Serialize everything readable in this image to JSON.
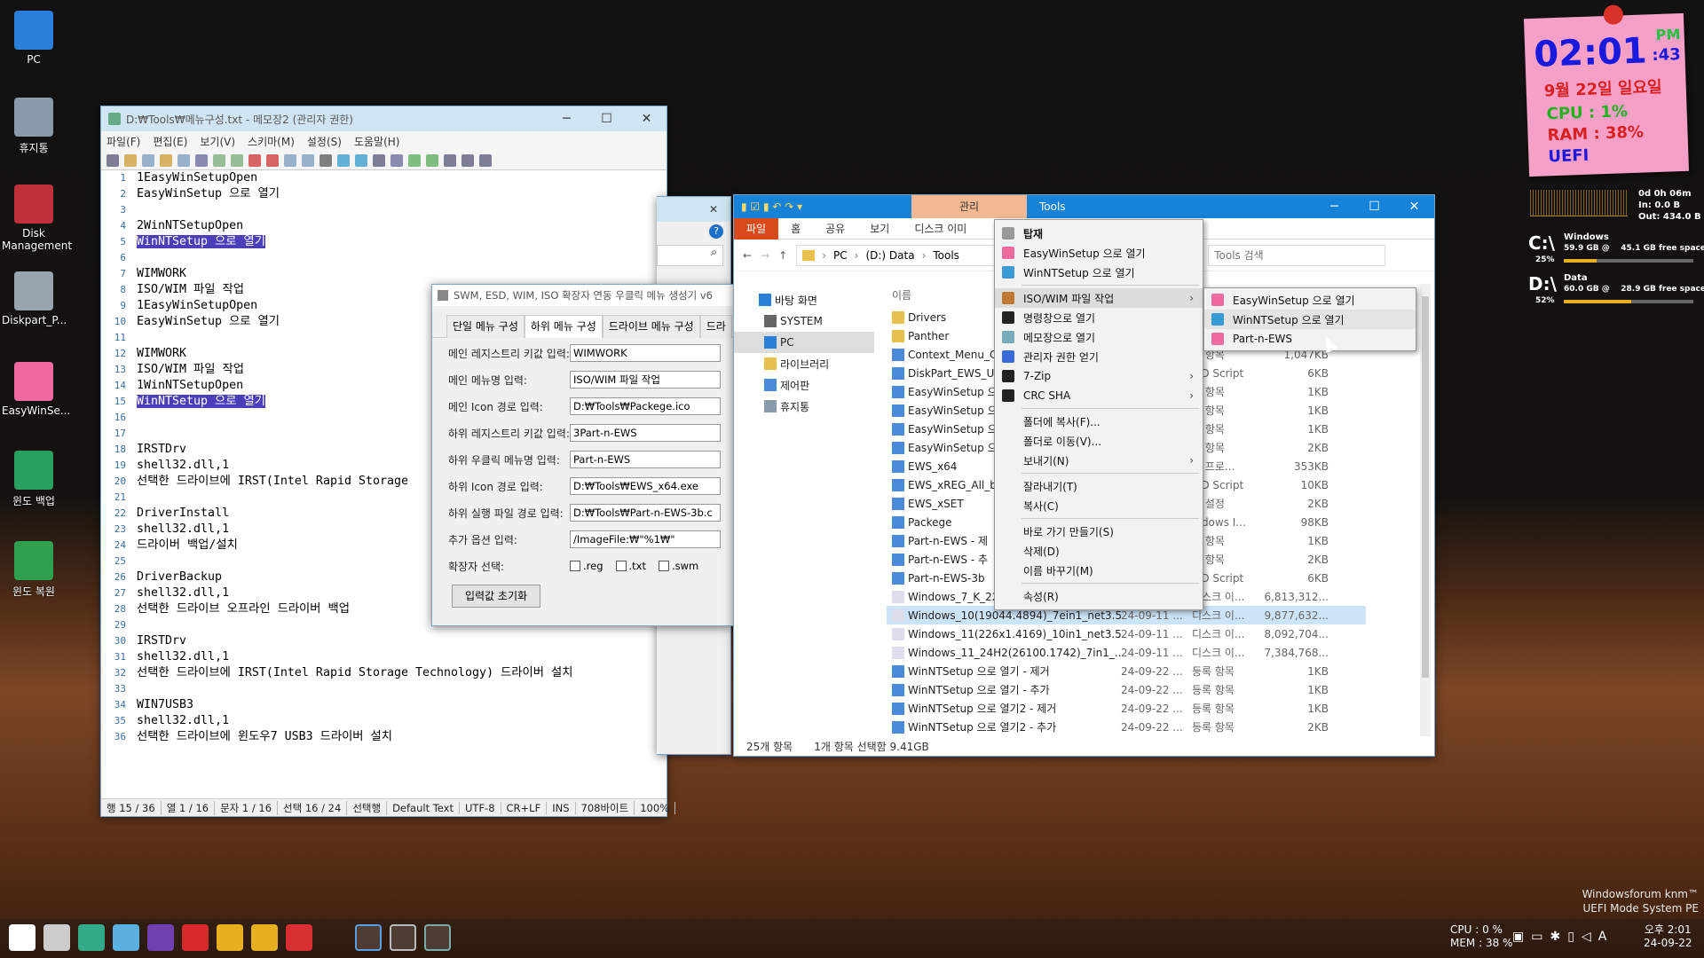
{
  "desktop": {
    "icons": [
      {
        "label": "PC"
      },
      {
        "label": "휴지통"
      },
      {
        "label": "Disk Management"
      },
      {
        "label": "Diskpart_P..."
      },
      {
        "label": "EasyWinSe..."
      },
      {
        "label": "윈도 백업"
      },
      {
        "label": "윈도 복원"
      }
    ],
    "watermark_line1": "Windowsforum knm™",
    "watermark_line2": "UEFI Mode System PE"
  },
  "sticky_clock": {
    "time": "02:01",
    "ampm": "PM",
    "seconds": ":43",
    "date": "9월 22일 일요일",
    "cpu": "CPU :  1%",
    "ram": "RAM :  38%",
    "mode": "UEFI"
  },
  "rainmeter": {
    "uptime": "0d 0h 06m",
    "net_in": "In: 0.0 B",
    "net_out": "Out: 434.0 B",
    "drives": [
      {
        "letter": "C:\\",
        "name": "Windows",
        "info": "59.9 GB @    45.1 GB free space",
        "pct": "25%",
        "fill": 0.25
      },
      {
        "letter": "D:\\",
        "name": "Data",
        "info": "60.0 GB @    28.9 GB free space",
        "pct": "52%",
        "fill": 0.52
      }
    ]
  },
  "notepad": {
    "title": "D:₩Tools₩메뉴구성.txt - 메모장2 (관리자 권한)",
    "menu": [
      "파일(F)",
      "편집(E)",
      "보기(V)",
      "스키마(M)",
      "설정(S)",
      "도움말(H)"
    ],
    "lines": [
      "1EasyWinSetupOpen",
      "EasyWinSetup 으로 열기",
      "",
      "2WinNTSetupOpen",
      "WinNTSetup 으로 열기",
      "",
      "WIMWORK",
      "ISO/WIM 파일 작업",
      "1EasyWinSetupOpen",
      "EasyWinSetup 으로 열기",
      "",
      "WIMWORK",
      "ISO/WIM 파일 작업",
      "1WinNTSetupOpen",
      "WinNTSetup 으로 열기",
      "",
      "",
      "IRSTDrv",
      "shell32.dll,1",
      "선택한 드라이브에 IRST(Intel Rapid Storage",
      "",
      "DriverInstall",
      "shell32.dll,1",
      "드라이버 백업/설치",
      "",
      "DriverBackup",
      "shell32.dll,1",
      "선택한 드라이브 오프라인 드라이버 백업",
      "",
      "IRSTDrv",
      "shell32.dll,1",
      "선택한 드라이브에 IRST(Intel Rapid Storage Technology) 드라이버 설치",
      "",
      "WIN7USB3",
      "shell32.dll,1",
      "선택한 드라이브에 윈도우7 USB3 드라이버 설치"
    ],
    "status": [
      "행 15 / 36",
      "열 1 / 16",
      "문자 1 / 16",
      "선택 16 / 24",
      "선택행",
      "Default Text",
      "UTF-8",
      "CR+LF",
      "INS",
      "708바이트",
      "100%"
    ]
  },
  "dialog": {
    "title": "SWM, ESD, WIM, ISO 확장자 연동 우클릭 메뉴 생성기 v6",
    "tabs": [
      "단일 메뉴 구성",
      "하위 메뉴 구성",
      "드라이브 메뉴 구성",
      "드라"
    ],
    "fields": [
      {
        "label": "메인 레지스트리 키값 입력:",
        "value": "WIMWORK"
      },
      {
        "label": "메인 메뉴명 입력:",
        "value": "ISO/WIM 파일 작업"
      },
      {
        "label": "메인 Icon 경로 입력:",
        "value": "D:₩Tools₩Packege.ico"
      },
      {
        "label": "하위 레지스트리 키값 입력:",
        "value": "3Part-n-EWS"
      },
      {
        "label": "하위 우클릭 메뉴명 입력:",
        "value": "Part-n-EWS"
      },
      {
        "label": "하위 Icon 경로 입력:",
        "value": "D:₩Tools₩EWS_x64.exe"
      },
      {
        "label": "하위 실행 파일 경로 입력:",
        "value": "D:₩Tools₩Part-n-EWS-3b.c"
      },
      {
        "label": "추가 옵션 입력:",
        "value": "/ImageFile:₩\"%1₩\""
      }
    ],
    "ext_label": "확장자 선택:",
    "exts": [
      ".reg",
      ".txt",
      ".swm"
    ],
    "reset_button": "입력값 초기화"
  },
  "explorer": {
    "title": "Tools",
    "manage_tab": "관리",
    "ribbon_tabs": [
      "파일",
      "홈",
      "공유",
      "보기",
      "디스크 이미"
    ],
    "breadcrumb": [
      "PC",
      "(D:) Data",
      "Tools"
    ],
    "search_placeholder": "Tools 검색",
    "nav": [
      "바탕 화면",
      "SYSTEM",
      "PC",
      "라이브러리",
      "제어판",
      "휴지통"
    ],
    "column_name": "이름",
    "files": [
      {
        "name": "Drivers",
        "date": "",
        "type": "",
        "size": ""
      },
      {
        "name": "Panther",
        "date": "",
        "type": "",
        "size": ""
      },
      {
        "name": "Context_Menu_C",
        "date": "",
        "type": "록 항목",
        "size": "1,047KB"
      },
      {
        "name": "DiskPart_EWS_U",
        "date": "",
        "type": "MD Script",
        "size": "6KB"
      },
      {
        "name": "EasyWinSetup 으",
        "date": "",
        "type": "록 항목",
        "size": "1KB"
      },
      {
        "name": "EasyWinSetup 으",
        "date": "",
        "type": "록 항목",
        "size": "1KB"
      },
      {
        "name": "EasyWinSetup 으",
        "date": "",
        "type": "록 항목",
        "size": "1KB"
      },
      {
        "name": "EasyWinSetup 으",
        "date": "",
        "type": "록 항목",
        "size": "2KB"
      },
      {
        "name": "EWS_x64",
        "date": "",
        "type": "용 프로...",
        "size": "353KB"
      },
      {
        "name": "EWS_xREG_All_b",
        "date": "",
        "type": "MD Script",
        "size": "10KB"
      },
      {
        "name": "EWS_xSET",
        "date": "",
        "type": "성 설정",
        "size": "2KB"
      },
      {
        "name": "Packege",
        "date": "",
        "type": "indows I...",
        "size": "98KB"
      },
      {
        "name": "Part-n-EWS - 제",
        "date": "",
        "type": "록 항목",
        "size": "1KB"
      },
      {
        "name": "Part-n-EWS - 추",
        "date": "",
        "type": "록 항목",
        "size": "2KB"
      },
      {
        "name": "Part-n-EWS-3b",
        "date": "",
        "type": "MD Script",
        "size": "6KB"
      },
      {
        "name": "Windows_7_K_22",
        "date": "",
        "type": "디스크 이...",
        "size": "6,813,312..."
      },
      {
        "name": "Windows_10(19044.4894)_7ein1_net3.5...",
        "date": "24-09-11 ...",
        "type": "디스크 이...",
        "size": "9,877,632..."
      },
      {
        "name": "Windows_11(226x1.4169)_10in1_net3.5...",
        "date": "24-09-11 ...",
        "type": "디스크 이...",
        "size": "8,092,704..."
      },
      {
        "name": "Windows_11_24H2(26100.1742)_7in1_...",
        "date": "24-09-11 ...",
        "type": "디스크 이...",
        "size": "7,384,768..."
      },
      {
        "name": "WinNTSetup 으로 열기 - 제거",
        "date": "24-09-22 ...",
        "type": "등록 항목",
        "size": "1KB"
      },
      {
        "name": "WinNTSetup 으로 열기 - 추가",
        "date": "24-09-22 ...",
        "type": "등록 항목",
        "size": "1KB"
      },
      {
        "name": "WinNTSetup 으로 열기2 - 제거",
        "date": "24-09-22 ...",
        "type": "등록 항목",
        "size": "1KB"
      },
      {
        "name": "WinNTSetup 으로 열기2 - 추가",
        "date": "24-09-22 ...",
        "type": "등록 항목",
        "size": "2KB"
      }
    ],
    "status_count": "25개 항목",
    "status_sel": "1개 항목 선택함 9.41GB"
  },
  "context_menu": {
    "items": [
      {
        "label": "탑재",
        "bold": true
      },
      {
        "label": "EasyWinSetup 으로 열기"
      },
      {
        "label": "WinNTSetup 으로 열기"
      },
      {
        "sep": true
      },
      {
        "label": "ISO/WIM 파일 작업",
        "sub": true
      },
      {
        "label": "명령창으로 열기"
      },
      {
        "label": "메모장으로 열기"
      },
      {
        "label": "관리자 권한 얻기"
      },
      {
        "label": "7-Zip",
        "sub": true
      },
      {
        "label": "CRC SHA",
        "sub": true
      },
      {
        "sep": true
      },
      {
        "label": "폴더에 복사(F)..."
      },
      {
        "label": "폴더로 이동(V)..."
      },
      {
        "label": "보내기(N)",
        "sub": true
      },
      {
        "sep": true
      },
      {
        "label": "잘라내기(T)"
      },
      {
        "label": "복사(C)"
      },
      {
        "sep": true
      },
      {
        "label": "바로 가기 만들기(S)"
      },
      {
        "label": "삭제(D)"
      },
      {
        "label": "이름 바꾸기(M)"
      },
      {
        "sep": true
      },
      {
        "label": "속성(R)"
      }
    ],
    "submenu": [
      "EasyWinSetup 으로 열기",
      "WinNTSetup 으로 열기",
      "Part-n-EWS"
    ]
  },
  "behind_window": {
    "help": "?"
  },
  "taskbar": {
    "cpu": "CPU :  0 %",
    "mem": "MEM : 38 %",
    "time": "오후 2:01",
    "date": "24-09-22",
    "ime": "A"
  }
}
